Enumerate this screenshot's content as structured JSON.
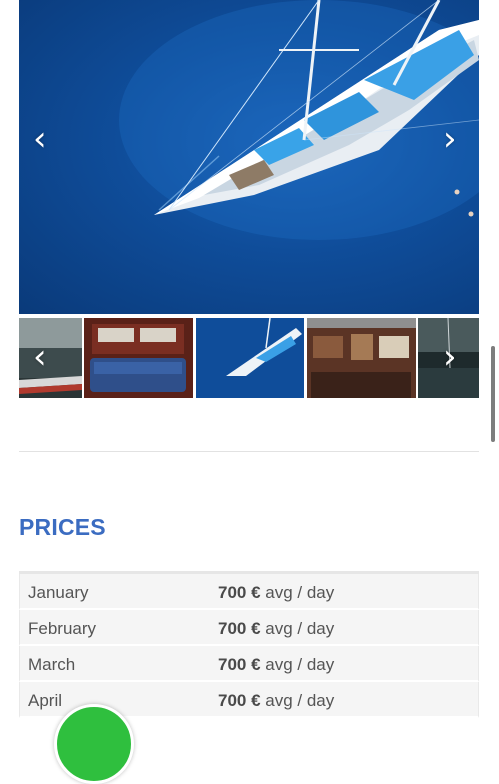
{
  "gallery": {
    "prev_glyph": "‹",
    "next_glyph": "›",
    "thumbnails": [
      {
        "name": "thumbnail-harbor"
      },
      {
        "name": "thumbnail-cabin-interior"
      },
      {
        "name": "thumbnail-aerial-yacht"
      },
      {
        "name": "thumbnail-saloon"
      },
      {
        "name": "thumbnail-evening-harbor"
      }
    ]
  },
  "prices": {
    "title": "PRICES",
    "rows": [
      {
        "month": "January",
        "amount": "700 €",
        "unit": " avg / day"
      },
      {
        "month": "February",
        "amount": "700 €",
        "unit": " avg / day"
      },
      {
        "month": "March",
        "amount": "700 €",
        "unit": " avg / day"
      },
      {
        "month": "April",
        "amount": "700 €",
        "unit": " avg / day"
      }
    ]
  },
  "colors": {
    "accent": "#3b6cc1",
    "sea": "#0f4d9a",
    "chat_green": "#2fbf3e"
  }
}
